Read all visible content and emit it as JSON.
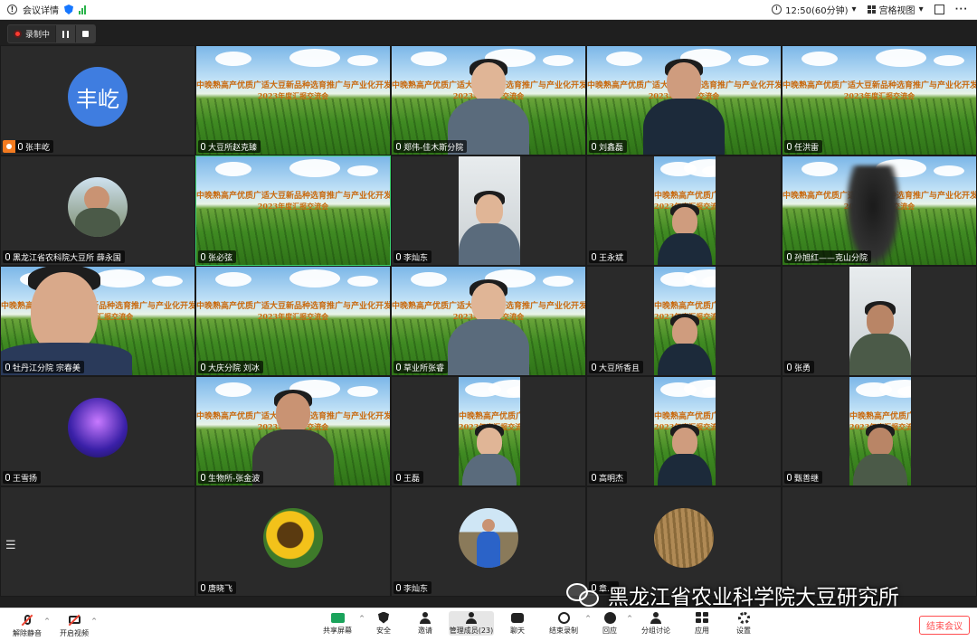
{
  "topbar": {
    "meeting_info": "会议详情",
    "time": "12:50(60分钟)",
    "view_mode": "宫格视图",
    "dropdown_caret": "▾",
    "more": "···"
  },
  "recording": {
    "label": "录制中"
  },
  "banner": {
    "line1": "中晚熟高产优质广适大豆新品种选育推广与产业化开发",
    "line2": "2023年度汇报交流会"
  },
  "participants": [
    {
      "name": "张丰屹",
      "avatar_text": "丰屹",
      "type": "avatar-text",
      "host": true
    },
    {
      "name": "大豆所赵克臻",
      "type": "banner"
    },
    {
      "name": "郑伟-佳木斯分院",
      "type": "banner-person"
    },
    {
      "name": "刘鑫磊",
      "type": "banner-person"
    },
    {
      "name": "任洪雷",
      "type": "banner"
    },
    {
      "name": "黑龙江省农科院大豆所 薛永国",
      "type": "avatar-photo"
    },
    {
      "name": "张必弦",
      "type": "banner",
      "active": true
    },
    {
      "name": "李灿东",
      "type": "portrait"
    },
    {
      "name": "王永斌",
      "type": "portrait-banner"
    },
    {
      "name": "孙旭红——克山分院",
      "type": "banner-blur"
    },
    {
      "name": "牡丹江分院 宗春美",
      "type": "banner-closeup"
    },
    {
      "name": "大庆分院  刘冰",
      "type": "banner"
    },
    {
      "name": "草业所张睿",
      "type": "banner-person"
    },
    {
      "name": "大豆所香且",
      "type": "portrait-banner"
    },
    {
      "name": "张勇",
      "type": "portrait"
    },
    {
      "name": "王雪扬",
      "type": "avatar-purple"
    },
    {
      "name": "生物所-张金波",
      "type": "banner-person"
    },
    {
      "name": "王磊",
      "type": "portrait-banner"
    },
    {
      "name": "高明杰",
      "type": "portrait-banner"
    },
    {
      "name": "甄善继",
      "type": "portrait-banner"
    },
    {
      "name": "",
      "type": "empty"
    },
    {
      "name": "唐晓飞",
      "type": "avatar-sunflower"
    },
    {
      "name": "李灿东",
      "type": "avatar-field"
    },
    {
      "name": "章...",
      "type": "avatar-soil"
    },
    {
      "name": "",
      "type": "empty"
    }
  ],
  "watermark": "黑龙江省农业科学院大豆研究所",
  "toolbar": {
    "unmute": "解除静音",
    "start_video": "开启视频",
    "share_screen": "共享屏幕",
    "security": "安全",
    "invite": "邀请",
    "manage_members": "管理成员(23)",
    "chat": "聊天",
    "end_recording": "结束录制",
    "reactions": "回应",
    "breakout": "分组讨论",
    "apps": "应用",
    "settings": "设置",
    "end_meeting": "结束会议",
    "caret": "^"
  },
  "colors": {
    "accent": "#1677ff",
    "active_speaker": "#3bd16f",
    "end": "#ff4d4f",
    "host": "#f47b20"
  }
}
